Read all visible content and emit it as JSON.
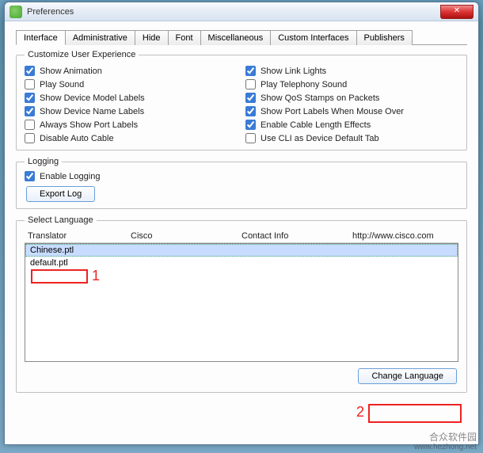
{
  "window": {
    "title": "Preferences",
    "close": "✕"
  },
  "tabs": {
    "t0": "Interface",
    "t1": "Administrative",
    "t2": "Hide",
    "t3": "Font",
    "t4": "Miscellaneous",
    "t5": "Custom Interfaces",
    "t6": "Publishers"
  },
  "groups": {
    "customize": "Customize User Experience",
    "logging": "Logging",
    "lang": "Select Language"
  },
  "opts": {
    "show_anim": {
      "label": "Show Animation",
      "checked": true
    },
    "show_link": {
      "label": "Show Link Lights",
      "checked": true
    },
    "play_sound": {
      "label": "Play Sound",
      "checked": false
    },
    "play_tel": {
      "label": "Play Telephony Sound",
      "checked": false
    },
    "dev_model": {
      "label": "Show Device Model Labels",
      "checked": true
    },
    "qos": {
      "label": "Show QoS Stamps on Packets",
      "checked": true
    },
    "dev_name": {
      "label": "Show Device Name Labels",
      "checked": true
    },
    "port_mouse": {
      "label": "Show Port Labels When Mouse Over",
      "checked": true
    },
    "always_port": {
      "label": "Always Show Port Labels",
      "checked": false
    },
    "cable_len": {
      "label": "Enable Cable Length Effects",
      "checked": true
    },
    "dis_auto": {
      "label": "Disable Auto Cable",
      "checked": false
    },
    "cli_def": {
      "label": "Use CLI as Device Default Tab",
      "checked": false
    }
  },
  "logging": {
    "enable": {
      "label": "Enable Logging",
      "checked": true
    },
    "export": "Export Log"
  },
  "lang": {
    "headers": {
      "translator": "Translator",
      "cisco": "Cisco",
      "contact": "Contact Info",
      "url": "http://www.cisco.com"
    },
    "row0": "Chinese.ptl",
    "row1": "default.ptl",
    "change": "Change Language"
  },
  "annotations": {
    "a1": "1",
    "a2": "2"
  },
  "watermark": {
    "line1": "合众软件园",
    "line2": "www.hezhong.net"
  }
}
